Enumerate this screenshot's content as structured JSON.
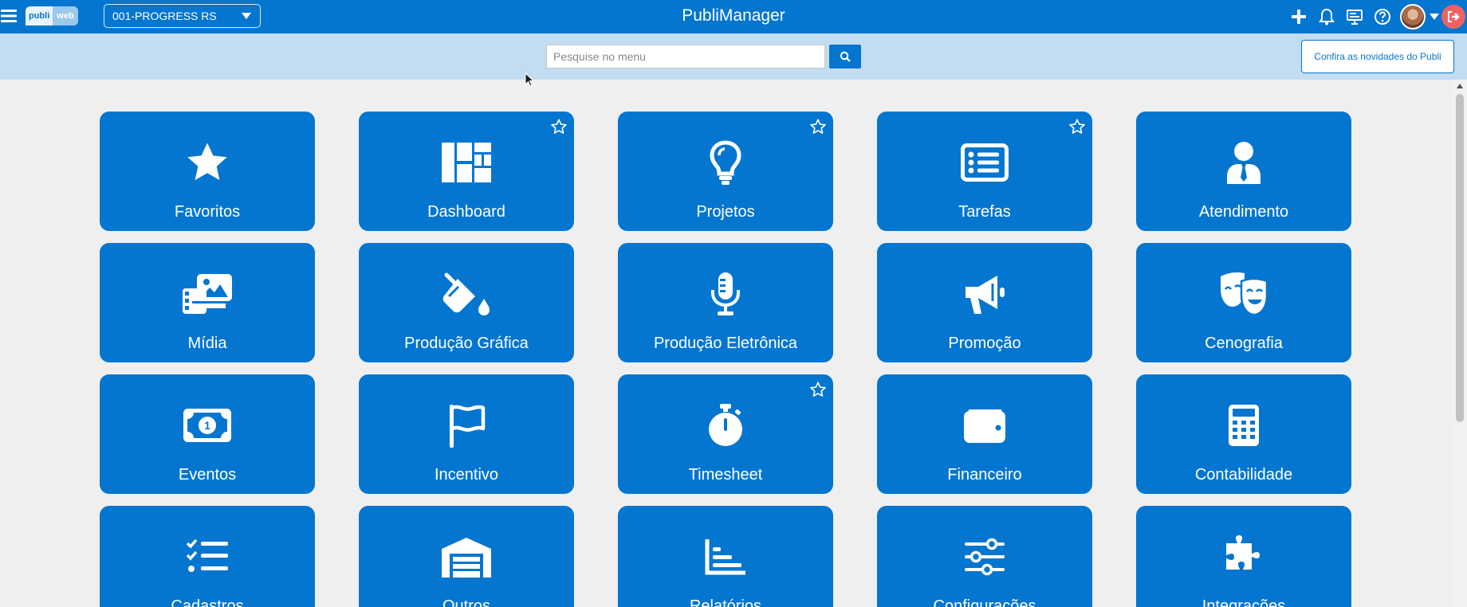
{
  "header": {
    "app_title": "PubliManager",
    "logo_part1": "publi",
    "logo_part2": "web",
    "company_select": "001-PROGRESS RS"
  },
  "search": {
    "placeholder": "Pesquise no menu",
    "value": "",
    "news_button": "Confira as novidades do Publi"
  },
  "colors": {
    "brand": "#0476d0",
    "search_strip": "#c2dcf1",
    "background": "#efefef",
    "logout": "#f06262"
  },
  "modules": [
    {
      "label": "Favoritos",
      "icon": "star-icon",
      "favorite_toggle": false
    },
    {
      "label": "Dashboard",
      "icon": "dashboard-icon",
      "favorite_toggle": true
    },
    {
      "label": "Projetos",
      "icon": "lightbulb-icon",
      "favorite_toggle": true
    },
    {
      "label": "Tarefas",
      "icon": "list-alt-icon",
      "favorite_toggle": true
    },
    {
      "label": "Atendimento",
      "icon": "user-tie-icon",
      "favorite_toggle": false
    },
    {
      "label": "Mídia",
      "icon": "photo-video-icon",
      "favorite_toggle": false
    },
    {
      "label": "Produção Gráfica",
      "icon": "fill-drip-icon",
      "favorite_toggle": false
    },
    {
      "label": "Produção Eletrônica",
      "icon": "microphone-icon",
      "favorite_toggle": false
    },
    {
      "label": "Promoção",
      "icon": "bullhorn-icon",
      "favorite_toggle": false
    },
    {
      "label": "Cenografia",
      "icon": "theater-masks-icon",
      "favorite_toggle": false
    },
    {
      "label": "Eventos",
      "icon": "money-bill-icon",
      "favorite_toggle": false
    },
    {
      "label": "Incentivo",
      "icon": "flag-icon",
      "favorite_toggle": false
    },
    {
      "label": "Timesheet",
      "icon": "stopwatch-icon",
      "favorite_toggle": true
    },
    {
      "label": "Financeiro",
      "icon": "wallet-icon",
      "favorite_toggle": false
    },
    {
      "label": "Contabilidade",
      "icon": "calculator-icon",
      "favorite_toggle": false
    },
    {
      "label": "Cadastros",
      "icon": "tasks-icon",
      "favorite_toggle": false
    },
    {
      "label": "Outros",
      "icon": "warehouse-icon",
      "favorite_toggle": false
    },
    {
      "label": "Relatórios",
      "icon": "chart-bar-icon",
      "favorite_toggle": false
    },
    {
      "label": "Configurações",
      "icon": "sliders-icon",
      "favorite_toggle": false
    },
    {
      "label": "Integrações",
      "icon": "puzzle-icon",
      "favorite_toggle": false
    }
  ]
}
